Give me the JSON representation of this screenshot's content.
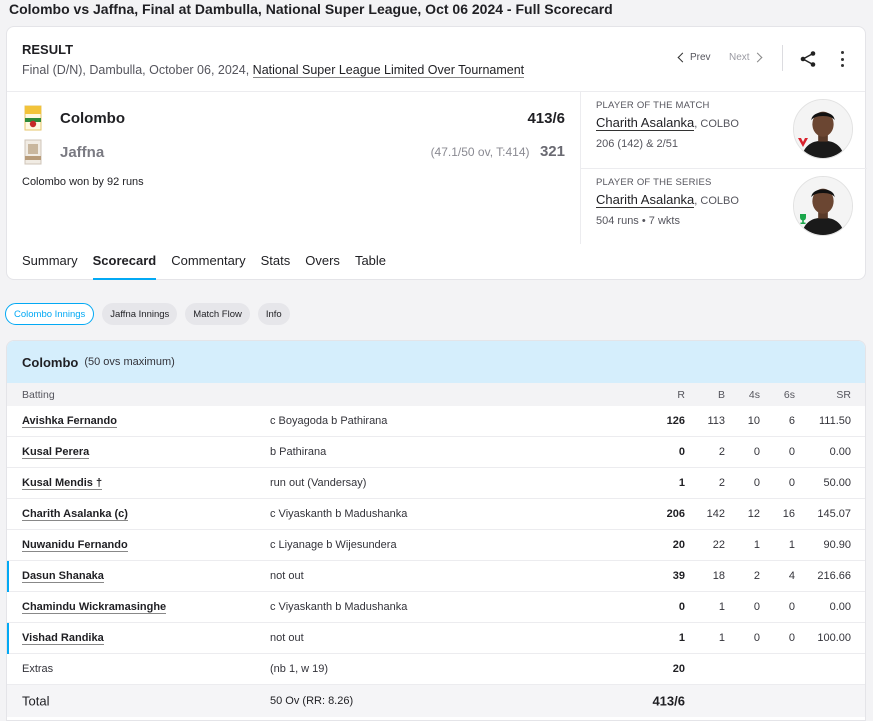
{
  "page_title": "Colombo vs Jaffna, Final at Dambulla, National Super League, Oct 06 2024 - Full Scorecard",
  "result": {
    "label": "RESULT",
    "subtitle": "Final (D/N), Dambulla, October 06, 2024,",
    "tournament_link": "National Super League Limited Over Tournament",
    "prev": "Prev",
    "next": "Next"
  },
  "teams": [
    {
      "name": "Colombo",
      "overs": "",
      "score": "413/6"
    },
    {
      "name": "Jaffna",
      "overs": "(47.1/50 ov, T:414)",
      "score": "321"
    }
  ],
  "match_result": "Colombo won by 92 runs",
  "awards": [
    {
      "label": "PLAYER OF THE MATCH",
      "player": "Charith Asalanka",
      "team": ", COLBO",
      "stat": "206 (142) & 2/51",
      "badge_color": "#d9232e"
    },
    {
      "label": "PLAYER OF THE SERIES",
      "player": "Charith Asalanka",
      "team": ", COLBO",
      "stat": "504 runs • 7 wkts",
      "badge_color": "#1aa64a"
    }
  ],
  "tabs": [
    "Summary",
    "Scorecard",
    "Commentary",
    "Stats",
    "Overs",
    "Table"
  ],
  "active_tab": "Scorecard",
  "pills": [
    "Colombo Innings",
    "Jaffna Innings",
    "Match Flow",
    "Info"
  ],
  "innings": {
    "team": "Colombo",
    "max": "(50 ovs maximum)",
    "headers": {
      "batting": "Batting",
      "r": "R",
      "b": "B",
      "fours": "4s",
      "sixes": "6s",
      "sr": "SR"
    },
    "batters": [
      {
        "name": "Avishka Fernando",
        "dismissal": "c Boyagoda b Pathirana",
        "r": "126",
        "b": "113",
        "fours": "10",
        "sixes": "6",
        "sr": "111.50",
        "marked": false
      },
      {
        "name": "Kusal Perera",
        "dismissal": "b Pathirana",
        "r": "0",
        "b": "2",
        "fours": "0",
        "sixes": "0",
        "sr": "0.00",
        "marked": false
      },
      {
        "name": "Kusal Mendis †",
        "dismissal": "run out (Vandersay)",
        "r": "1",
        "b": "2",
        "fours": "0",
        "sixes": "0",
        "sr": "50.00",
        "marked": false
      },
      {
        "name": "Charith Asalanka (c)",
        "dismissal": "c Viyaskanth b Madushanka",
        "r": "206",
        "b": "142",
        "fours": "12",
        "sixes": "16",
        "sr": "145.07",
        "marked": false
      },
      {
        "name": "Nuwanidu Fernando",
        "dismissal": "c Liyanage b Wijesundera",
        "r": "20",
        "b": "22",
        "fours": "1",
        "sixes": "1",
        "sr": "90.90",
        "marked": false
      },
      {
        "name": "Dasun Shanaka",
        "dismissal": "not out",
        "r": "39",
        "b": "18",
        "fours": "2",
        "sixes": "4",
        "sr": "216.66",
        "marked": true
      },
      {
        "name": "Chamindu Wickramasinghe",
        "dismissal": "c Viyaskanth b Madushanka",
        "r": "0",
        "b": "1",
        "fours": "0",
        "sixes": "0",
        "sr": "0.00",
        "marked": false
      },
      {
        "name": "Vishad Randika",
        "dismissal": "not out",
        "r": "1",
        "b": "1",
        "fours": "0",
        "sixes": "0",
        "sr": "100.00",
        "marked": true
      }
    ],
    "extras": {
      "label": "Extras",
      "detail": "(nb 1, w 19)",
      "runs": "20"
    },
    "total": {
      "label": "Total",
      "detail": "50 Ov (RR: 8.26)",
      "score": "413/6"
    }
  },
  "colors": {
    "accent": "#03a9f4",
    "innings_header_bg": "#d5eefc"
  }
}
